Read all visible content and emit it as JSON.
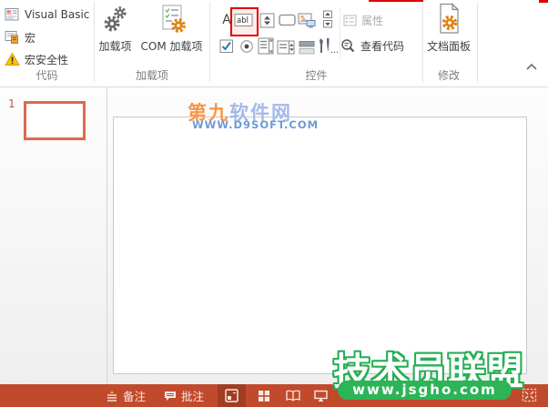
{
  "ribbon": {
    "code": {
      "label": "代码",
      "visual_basic": "Visual Basic",
      "macro": "宏",
      "macro_security": "宏安全性"
    },
    "addins": {
      "label": "加载项",
      "addins_button": "加载项",
      "com_addins_button": "COM 加载项"
    },
    "controls": {
      "label": "控件",
      "label_control_glyph": "A",
      "textbox_glyph": "abl",
      "more_controls_ellipsis": "…",
      "properties": "属性",
      "view_code": "查看代码"
    },
    "modify": {
      "label": "修改",
      "document_panel": "文档面板"
    }
  },
  "slide_panel": {
    "slide_number": "1"
  },
  "canvas_watermark": {
    "site_name_orange": "第九",
    "site_name_blue": "软件网",
    "site_url": "WWW.D9SOFT.COM"
  },
  "overlay_badge": {
    "site_name": "技术员联盟",
    "site_url": "www.jsgho.com"
  },
  "status_bar": {
    "notes": "备注",
    "comments": "批注"
  },
  "colors": {
    "status_bar_red": "#C14A2D",
    "view_button_pressed": "#A23C22",
    "highlight_red": "#E10000",
    "badge_green": "#2CB457",
    "accent_orange": "#E08214",
    "selected_thumbnail_border": "#DD6A4E",
    "watermark_orange": "#F79646",
    "watermark_blue": "#A3B9EA"
  }
}
